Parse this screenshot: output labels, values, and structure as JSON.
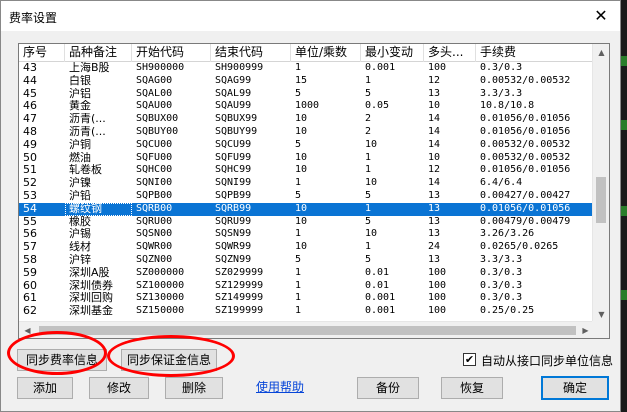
{
  "dialog": {
    "title": "费率设置",
    "close_glyph": "✕"
  },
  "columns": [
    "序号",
    "品种备注",
    "开始代码",
    "结束代码",
    "单位/乘数",
    "最小变动",
    "多头...",
    "手续费"
  ],
  "rows": [
    [
      "43",
      "上海B股",
      "SH900000",
      "SH900999",
      "1",
      "0.001",
      "100",
      "0.3/0.3"
    ],
    [
      "44",
      "白银",
      "SQAG00",
      "SQAG99",
      "15",
      "1",
      "12",
      "0.00532/0.00532"
    ],
    [
      "45",
      "沪铝",
      "SQAL00",
      "SQAL99",
      "5",
      "5",
      "13",
      "3.3/3.3"
    ],
    [
      "46",
      "黄金",
      "SQAU00",
      "SQAU99",
      "1000",
      "0.05",
      "10",
      "10.8/10.8"
    ],
    [
      "47",
      "沥青(...",
      "SQBUX00",
      "SQBUX99",
      "10",
      "2",
      "14",
      "0.01056/0.01056"
    ],
    [
      "48",
      "沥青(...",
      "SQBUY00",
      "SQBUY99",
      "10",
      "2",
      "14",
      "0.01056/0.01056"
    ],
    [
      "49",
      "沪铜",
      "SQCU00",
      "SQCU99",
      "5",
      "10",
      "14",
      "0.00532/0.00532"
    ],
    [
      "50",
      "燃油",
      "SQFU00",
      "SQFU99",
      "10",
      "1",
      "10",
      "0.00532/0.00532"
    ],
    [
      "51",
      "轧卷板",
      "SQHC00",
      "SQHC99",
      "10",
      "1",
      "12",
      "0.01056/0.01056"
    ],
    [
      "52",
      "沪镍",
      "SQNI00",
      "SQNI99",
      "1",
      "10",
      "14",
      "6.4/6.4"
    ],
    [
      "53",
      "沪铅",
      "SQPB00",
      "SQPB99",
      "5",
      "5",
      "13",
      "0.00427/0.00427"
    ],
    [
      "54",
      "螺纹钢",
      "SQRB00",
      "SQRB99",
      "10",
      "1",
      "13",
      "0.01056/0.01056"
    ],
    [
      "55",
      "橡胶",
      "SQRU00",
      "SQRU99",
      "10",
      "5",
      "13",
      "0.00479/0.00479"
    ],
    [
      "56",
      "沪锡",
      "SQSN00",
      "SQSN99",
      "1",
      "10",
      "13",
      "3.26/3.26"
    ],
    [
      "57",
      "线材",
      "SQWR00",
      "SQWR99",
      "10",
      "1",
      "24",
      "0.0265/0.0265"
    ],
    [
      "58",
      "沪锌",
      "SQZN00",
      "SQZN99",
      "5",
      "5",
      "13",
      "3.3/3.3"
    ],
    [
      "59",
      "深圳A股",
      "SZ000000",
      "SZ029999",
      "1",
      "0.01",
      "100",
      "0.3/0.3"
    ],
    [
      "60",
      "深圳债券",
      "SZ100000",
      "SZ129999",
      "1",
      "0.01",
      "100",
      "0.3/0.3"
    ],
    [
      "61",
      "深圳回购",
      "SZ130000",
      "SZ149999",
      "1",
      "0.001",
      "100",
      "0.3/0.3"
    ],
    [
      "62",
      "深圳基金",
      "SZ150000",
      "SZ199999",
      "1",
      "0.001",
      "100",
      "0.25/0.25"
    ]
  ],
  "selected_row": 11,
  "buttons": {
    "sync_fee": "同步费率信息",
    "sync_margin": "同步保证金信息",
    "add": "添加",
    "modify": "修改",
    "delete": "删除",
    "help": "使用帮助",
    "backup": "备份",
    "restore": "恢复",
    "ok": "确定"
  },
  "auto_sync": {
    "label": "自动从接口同步单位信息",
    "checked": true
  },
  "colors": {
    "selection": "#0a74d4",
    "annotation": "#ff0000",
    "link": "#0645d8"
  }
}
